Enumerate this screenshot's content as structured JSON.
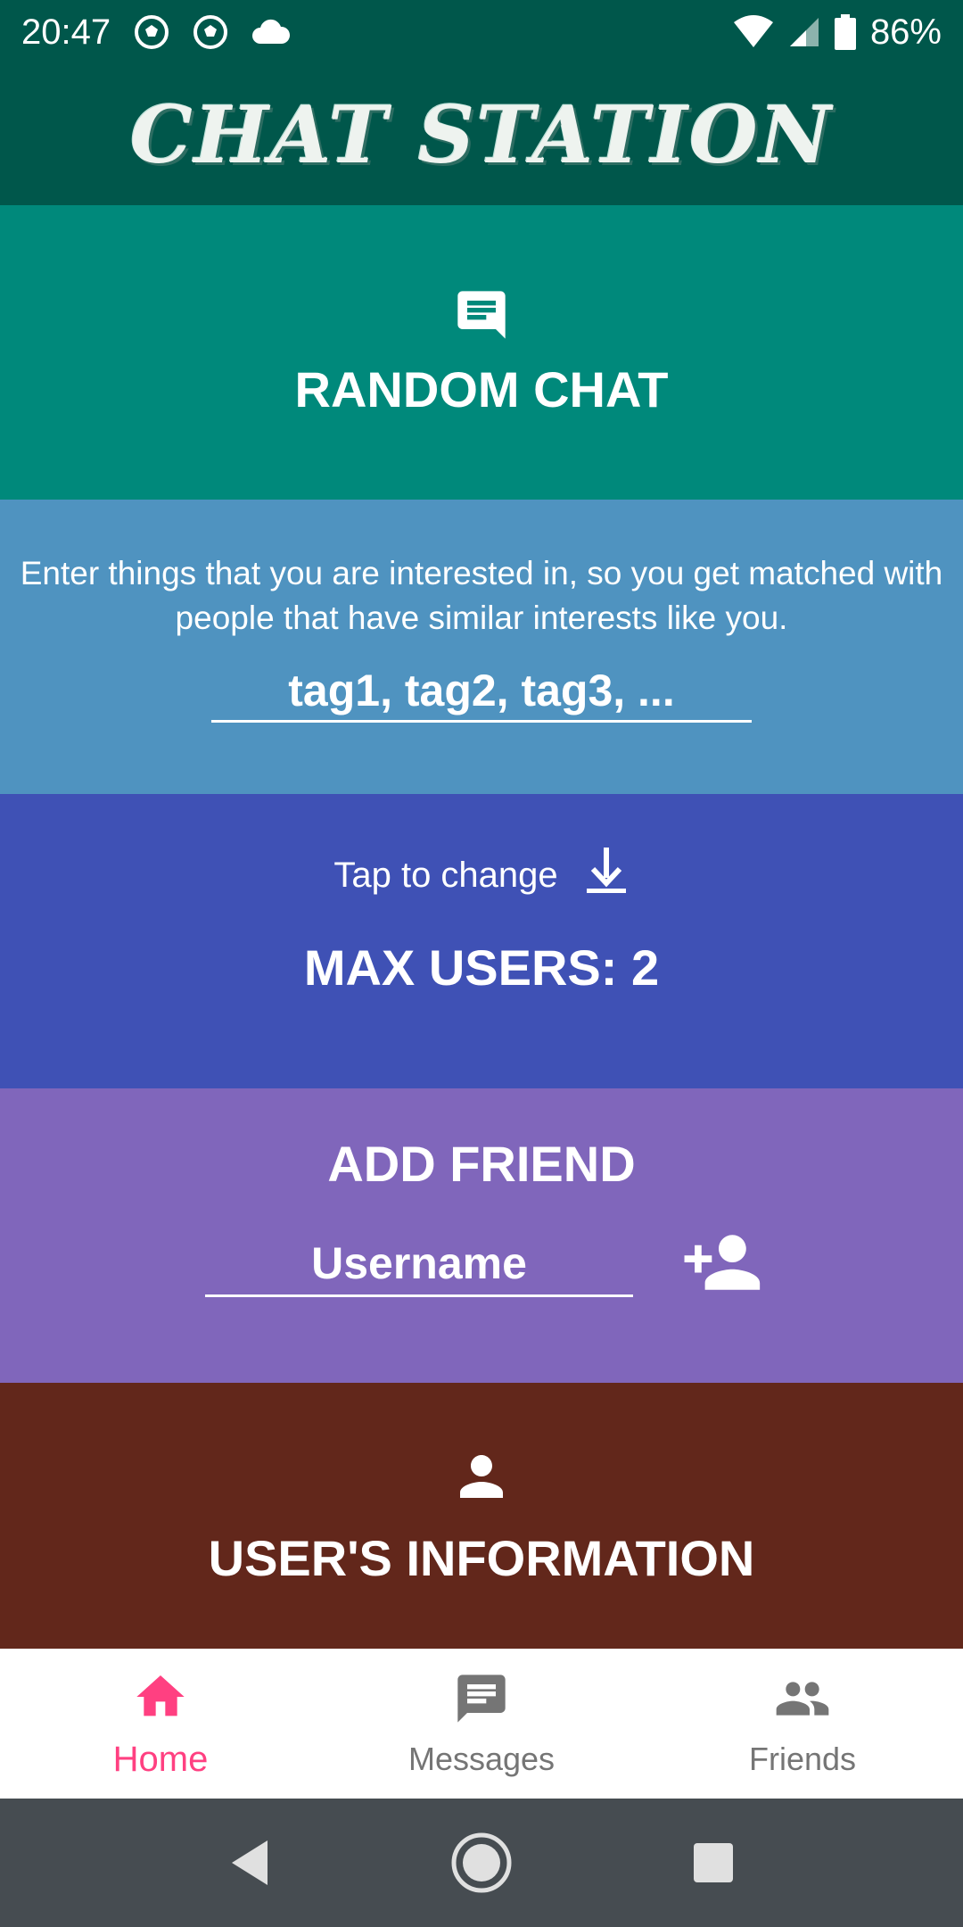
{
  "status_bar": {
    "time": "20:47",
    "battery": "86%",
    "icons": [
      "soccer-ball-icon",
      "soccer-ball-icon",
      "cloud-icon",
      "wifi-icon",
      "signal-icon",
      "battery-icon"
    ]
  },
  "header": {
    "title": "CHAT STATION"
  },
  "random_chat": {
    "label": "RANDOM CHAT",
    "icon": "chat-bubble-icon"
  },
  "tags": {
    "description": "Enter things that you are interested in, so you get matched with people that have similar interests like you.",
    "placeholder": "tag1, tag2, tag3, ...",
    "value": ""
  },
  "max_users": {
    "hint": "Tap to change",
    "icon": "download-arrow-icon",
    "label": "MAX USERS: 2"
  },
  "add_friend": {
    "label": "ADD FRIEND",
    "placeholder": "Username",
    "value": "",
    "icon": "person-add-icon"
  },
  "user_info": {
    "label": "USER'S INFORMATION",
    "icon": "person-icon"
  },
  "bottom_nav": {
    "items": [
      {
        "label": "Home",
        "icon": "home-icon",
        "active": true
      },
      {
        "label": "Messages",
        "icon": "message-icon",
        "active": false
      },
      {
        "label": "Friends",
        "icon": "people-icon",
        "active": false
      }
    ]
  },
  "system_nav": {
    "buttons": [
      "back-icon",
      "home-circle-icon",
      "recents-icon"
    ]
  },
  "colors": {
    "header": "#00574b",
    "random_chat": "#00897b",
    "tags": "#4f93c0",
    "max_users": "#3f51b5",
    "add_friend": "#8066bb",
    "user_info": "#62271b",
    "accent": "#ff4081",
    "nav_inactive": "#757575"
  }
}
